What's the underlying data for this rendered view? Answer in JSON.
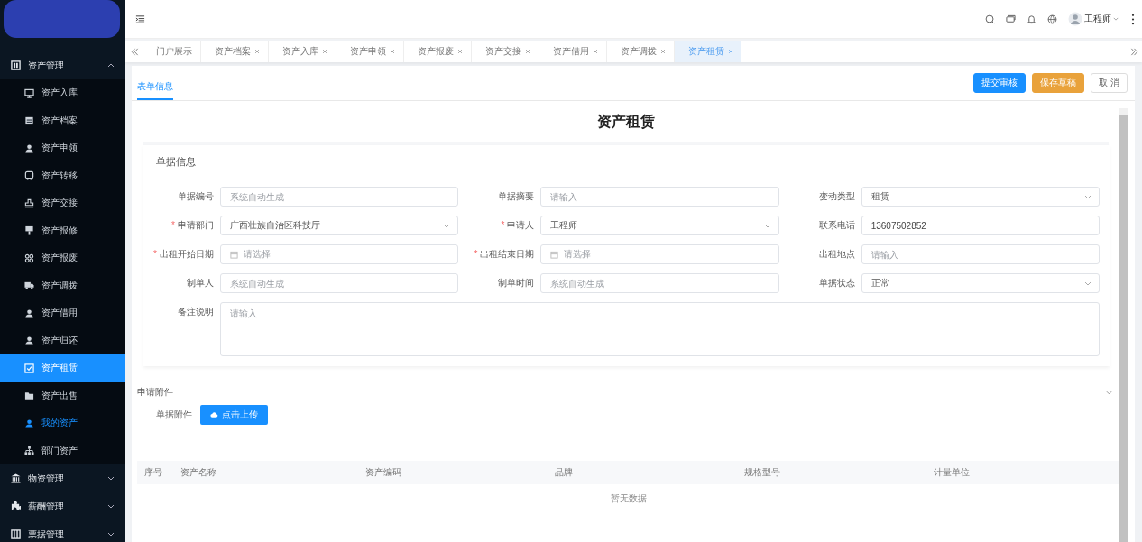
{
  "sidebar": {
    "groups": [
      {
        "label": "资产管理",
        "expanded": true,
        "children": [
          {
            "label": "资产入库",
            "selected": false,
            "highlighted": false
          },
          {
            "label": "资产档案",
            "selected": false,
            "highlighted": false
          },
          {
            "label": "资产申领",
            "selected": false,
            "highlighted": false
          },
          {
            "label": "资产转移",
            "selected": false,
            "highlighted": false
          },
          {
            "label": "资产交接",
            "selected": false,
            "highlighted": false
          },
          {
            "label": "资产报修",
            "selected": false,
            "highlighted": false
          },
          {
            "label": "资产报废",
            "selected": false,
            "highlighted": false
          },
          {
            "label": "资产调拨",
            "selected": false,
            "highlighted": false
          },
          {
            "label": "资产借用",
            "selected": false,
            "highlighted": false
          },
          {
            "label": "资产归还",
            "selected": false,
            "highlighted": false
          },
          {
            "label": "资产租赁",
            "selected": true,
            "highlighted": false
          },
          {
            "label": "资产出售",
            "selected": false,
            "highlighted": false
          },
          {
            "label": "我的资产",
            "selected": false,
            "highlighted": true
          },
          {
            "label": "部门资产",
            "selected": false,
            "highlighted": false
          }
        ]
      },
      {
        "label": "物资管理",
        "expanded": false
      },
      {
        "label": "薪酬管理",
        "expanded": false
      },
      {
        "label": "票据管理",
        "expanded": false
      }
    ]
  },
  "header": {
    "user": "工程师"
  },
  "tabs": [
    {
      "label": "门户展示",
      "closable": false,
      "selected": false
    },
    {
      "label": "资产档案",
      "closable": true,
      "selected": false
    },
    {
      "label": "资产入库",
      "closable": true,
      "selected": false
    },
    {
      "label": "资产申领",
      "closable": true,
      "selected": false
    },
    {
      "label": "资产报废",
      "closable": true,
      "selected": false
    },
    {
      "label": "资产交接",
      "closable": true,
      "selected": false
    },
    {
      "label": "资产借用",
      "closable": true,
      "selected": false
    },
    {
      "label": "资产调拨",
      "closable": true,
      "selected": false
    },
    {
      "label": "资产租赁",
      "closable": true,
      "selected": true
    }
  ],
  "subtabs": [
    {
      "label": "表单信息",
      "selected": true
    }
  ],
  "actions": [
    {
      "label": "提交审核",
      "kind": "primary"
    },
    {
      "label": "保存草稿",
      "kind": "warning"
    },
    {
      "label": "取 消",
      "kind": "plain"
    }
  ],
  "form": {
    "title": "资产租赁",
    "section": "单据信息",
    "required_mark": "*",
    "fields": [
      {
        "label": "单据编号",
        "required": false,
        "kind": "text",
        "placeholder": "系统自动生成"
      },
      {
        "label": "单据摘要",
        "required": false,
        "kind": "text",
        "placeholder": "请输入"
      },
      {
        "label": "变动类型",
        "required": false,
        "kind": "select",
        "value": "租赁"
      },
      {
        "label": "申请部门",
        "required": true,
        "kind": "select",
        "value": "广西壮族自治区科技厅"
      },
      {
        "label": "申请人",
        "required": true,
        "kind": "select",
        "value": "工程师"
      },
      {
        "label": "联系电话",
        "required": false,
        "kind": "text",
        "value": "13607502852"
      },
      {
        "label": "出租开始日期",
        "required": true,
        "kind": "date",
        "placeholder": "请选择"
      },
      {
        "label": "出租结束日期",
        "required": true,
        "kind": "date",
        "placeholder": "请选择"
      },
      {
        "label": "出租地点",
        "required": false,
        "kind": "text",
        "placeholder": "请输入"
      },
      {
        "label": "制单人",
        "required": false,
        "kind": "text",
        "placeholder": "系统自动生成"
      },
      {
        "label": "制单时间",
        "required": false,
        "kind": "text",
        "placeholder": "系统自动生成"
      },
      {
        "label": "单据状态",
        "required": false,
        "kind": "select",
        "value": "正常"
      },
      {
        "label": "备注说明",
        "required": false,
        "kind": "textarea",
        "placeholder": "请输入"
      }
    ]
  },
  "attachments": {
    "title": "申请附件",
    "expanded": true,
    "label": "单据附件",
    "button": "点击上传"
  },
  "table": {
    "columns": [
      "序号",
      "资产名称",
      "资产编码",
      "品牌",
      "规格型号",
      "计量单位"
    ],
    "empty": "暂无数据"
  }
}
